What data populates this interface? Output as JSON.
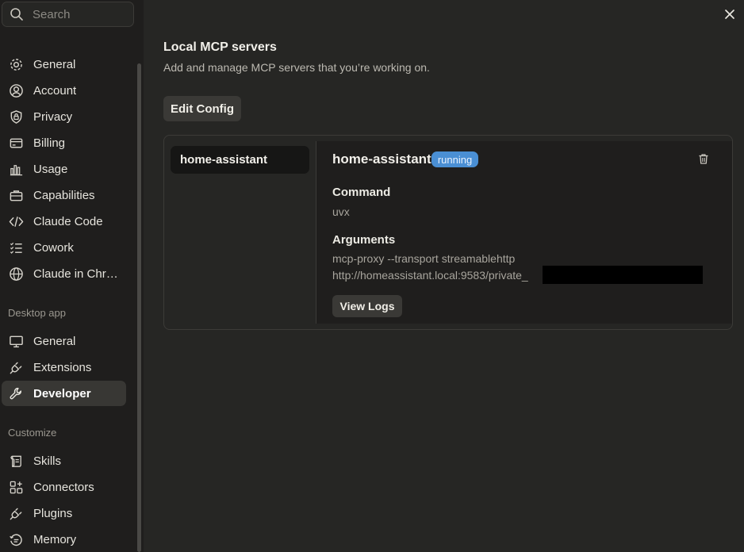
{
  "search": {
    "placeholder": "Search"
  },
  "sidebar": {
    "items": [
      {
        "label": "General",
        "icon": "gear-icon"
      },
      {
        "label": "Account",
        "icon": "user-circle-icon"
      },
      {
        "label": "Privacy",
        "icon": "shield-lock-icon"
      },
      {
        "label": "Billing",
        "icon": "credit-card-icon"
      },
      {
        "label": "Usage",
        "icon": "bar-chart-icon"
      },
      {
        "label": "Capabilities",
        "icon": "briefcase-icon"
      },
      {
        "label": "Claude Code",
        "icon": "code-icon"
      },
      {
        "label": "Cowork",
        "icon": "list-check-icon"
      },
      {
        "label": "Claude in Chr…",
        "icon": "globe-icon"
      }
    ],
    "desktop_label": "Desktop app",
    "desktop_items": [
      {
        "label": "General",
        "icon": "monitor-icon"
      },
      {
        "label": "Extensions",
        "icon": "plug-icon"
      },
      {
        "label": "Developer",
        "icon": "wrench-icon",
        "active": true
      }
    ],
    "customize_label": "Customize",
    "customize_items": [
      {
        "label": "Skills",
        "icon": "scroll-icon"
      },
      {
        "label": "Connectors",
        "icon": "grid-plus-icon"
      },
      {
        "label": "Plugins",
        "icon": "plug-icon"
      },
      {
        "label": "Memory",
        "icon": "memory-icon"
      }
    ]
  },
  "main": {
    "title": "Local MCP servers",
    "subtitle": "Add and manage MCP servers that you’re working on.",
    "edit_config_label": "Edit Config",
    "servers": [
      {
        "name": "home-assistant"
      }
    ],
    "detail": {
      "name": "home-assistant",
      "status": "running",
      "command_label": "Command",
      "command": "uvx",
      "arguments_label": "Arguments",
      "arguments_line1": "mcp-proxy --transport streamablehttp",
      "arguments_line2": "http://homeassistant.local:9583/private_",
      "view_logs_label": "View Logs"
    }
  },
  "colors": {
    "badge": "#4a8fd4",
    "background": "#262624",
    "sidebar": "#1f1e1d"
  }
}
